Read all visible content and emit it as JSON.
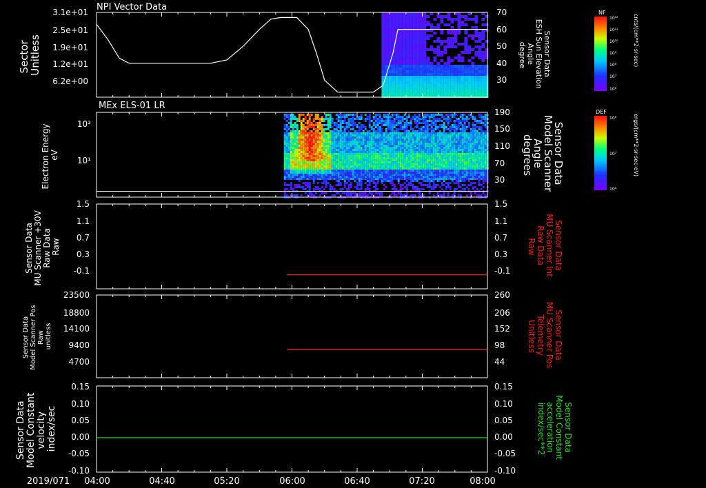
{
  "colors": {
    "white": "#ffffff",
    "red": "#ff1a1a",
    "green": "#22dd22",
    "background": "#000000"
  },
  "time_axis": {
    "date_label": "2019/071",
    "ticks": [
      "04:00",
      "04:40",
      "05:20",
      "06:00",
      "06:40",
      "07:20",
      "08:00"
    ],
    "range": [
      "04:00",
      "08:00"
    ]
  },
  "panels": {
    "p1": {
      "title": "NPI Vector Data",
      "ylabel_left": [
        "Sector",
        "Unitless"
      ],
      "yticks_left": [
        "3.1e+01",
        "2.5e+01",
        "1.9e+01",
        "1.2e+01",
        "6.2e+00"
      ],
      "ylabel_right": [
        "Sensor Data",
        "ESH Sun Elevation",
        "Angle",
        "degree"
      ],
      "yticks_right": [
        "70",
        "60",
        "50",
        "40",
        "30"
      ],
      "colorbar_label": "NF",
      "colorbar_ticks": [
        "10¹²",
        "10¹¹",
        "10¹⁰",
        "10⁹",
        "10⁸",
        "10⁷",
        "10⁶"
      ],
      "colorbar_units": "cnts/(cm**2-sr-sec)"
    },
    "p2": {
      "title": "MEx ELS-01 LR",
      "ylabel_left": [
        "Electron Energy",
        "eV"
      ],
      "yticks_left": [
        "10²",
        "10¹"
      ],
      "ylabel_right": [
        "Sensor Data",
        "Model Scanner",
        "Angle",
        "degrees"
      ],
      "yticks_right": [
        "190",
        "150",
        "110",
        "70",
        "30"
      ],
      "colorbar_label": "DEF",
      "colorbar_ticks": [
        "10⁸",
        "10⁷",
        "10⁶"
      ],
      "colorbar_units": "ergs/(cm**2-sr-sec-eV)"
    },
    "p3": {
      "ylabel_left": [
        "Sensor Data",
        "MU Scanner +30V",
        "Raw Data",
        "Raw"
      ],
      "yticks_left": [
        "1.5",
        "1.1",
        "0.7",
        "0.3",
        "-0.1"
      ],
      "ylabel_right": [
        "Sensor Data",
        "MU Scanner Int",
        "Raw Data",
        "Raw"
      ],
      "yticks_right": [
        "1.5",
        "1.1",
        "0.7",
        "0.3",
        "-0.1"
      ]
    },
    "p4": {
      "ylabel_left": [
        "Sensor Data",
        "Model Scanner Pos",
        "Raw",
        "unitless"
      ],
      "yticks_left": [
        "23500",
        "18800",
        "14100",
        "9400",
        "4700"
      ],
      "ylabel_right": [
        "Sensor Data",
        "MU Scanner Pos",
        "Telemetry",
        "Unitless"
      ],
      "yticks_right": [
        "260",
        "206",
        "152",
        "98",
        "44"
      ]
    },
    "p5": {
      "ylabel_left": [
        "Sensor Data",
        "Model Constant",
        "velocity",
        "index/sec"
      ],
      "yticks_left": [
        "0.15",
        "0.10",
        "0.05",
        "0.00",
        "-0.05",
        "-0.10"
      ],
      "ylabel_right": [
        "Sensor Data",
        "Model Constant",
        "acceleration",
        "index/sec**2"
      ],
      "yticks_right": [
        "0.15",
        "0.10",
        "0.05",
        "0.00",
        "-0.05",
        "-0.10"
      ]
    }
  },
  "chart_data": [
    {
      "type": "line",
      "title": "NPI Vector Data",
      "series": [
        {
          "name": "ESH Sun Elevation Angle",
          "axis": "right",
          "x": [
            "04:00",
            "04:07",
            "04:14",
            "04:20",
            "04:30",
            "04:40",
            "04:50",
            "05:00",
            "05:10",
            "05:20",
            "05:30",
            "05:40",
            "05:47",
            "05:53",
            "05:58",
            "06:03",
            "06:10",
            "06:15",
            "06:20",
            "06:28",
            "06:36",
            "06:45",
            "06:50",
            "06:56",
            "07:02",
            "07:05",
            "08:00"
          ],
          "y": [
            63,
            54,
            43,
            40,
            40,
            40,
            40,
            40,
            40,
            42,
            50,
            60,
            66,
            67,
            67,
            67,
            60,
            46,
            30,
            23,
            23,
            23,
            23,
            27,
            46,
            60,
            60
          ]
        }
      ],
      "ylim_right": [
        20,
        70
      ]
    },
    {
      "type": "heatmap",
      "title": "MEx ELS-01 LR",
      "ylabel": "Electron Energy eV",
      "x_range": [
        "05:55",
        "08:00"
      ],
      "notes_series": [
        {
          "name": "Model Scanner Angle",
          "x": [
            "04:00",
            "08:00"
          ],
          "y": [
            10,
            10
          ]
        }
      ]
    },
    {
      "type": "line",
      "series": [
        {
          "name": "MU Scanner Int Raw",
          "axis": "right",
          "x": [
            "05:57",
            "08:00"
          ],
          "y": [
            0.0,
            0.0
          ]
        }
      ],
      "ylim": [
        -0.3,
        1.5
      ]
    },
    {
      "type": "line",
      "series": [
        {
          "name": "MU Scanner Pos Telemetry",
          "axis": "right",
          "x": [
            "05:57",
            "08:00"
          ],
          "y": [
            88,
            88
          ]
        }
      ],
      "ylim_right": [
        0,
        260
      ]
    },
    {
      "type": "line",
      "series": [
        {
          "name": "Model Constant velocity",
          "axis": "left",
          "x": [
            "04:00",
            "08:00"
          ],
          "y": [
            0.0,
            0.0
          ]
        }
      ],
      "ylim": [
        -0.1,
        0.15
      ]
    }
  ]
}
